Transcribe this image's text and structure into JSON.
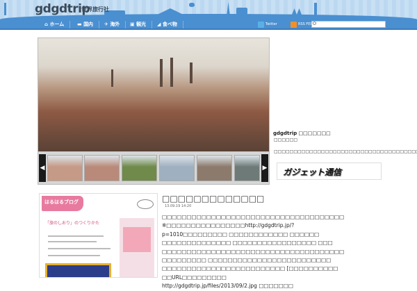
{
  "header": {
    "logo": "gdgdtrip",
    "logo_sub": "世界旅行社",
    "nav": [
      {
        "label": "ホーム",
        "icon": "home-icon"
      },
      {
        "label": "国内",
        "icon": "car-icon"
      },
      {
        "label": "海外",
        "icon": "plane-icon"
      },
      {
        "label": "観光",
        "icon": "camera-icon"
      },
      {
        "label": "食べ物",
        "icon": "food-icon"
      }
    ],
    "twitter_label": "Twitter",
    "rss_label": "RSS FEED",
    "search_placeholder": ""
  },
  "slider": {
    "prev_label": "◀",
    "next_label": "▶",
    "thumbs": [
      "#c59a86",
      "#b98a7a",
      "#6f8a4a",
      "#9fb0c0",
      "#8c7a6c",
      "#6d7a78"
    ]
  },
  "sidebar": {
    "title": "gdgdtrip",
    "title_suffix": "□□□□□□□",
    "subtitle": "□□□□□□",
    "description": "□□□□□□□□□□□□□□□□□□□□□□□□□□□□□□□□□□□□□□□",
    "banner_label": "ガジェット通信"
  },
  "post": {
    "thumb_blog": "はるはるブログ",
    "thumb_title": "「旅のしおり」のつくりかた",
    "title": "□□□□□□□□□□□□□",
    "date": "13.09.19 14:20",
    "body": [
      "□□□□□□□□□□□□□□□□□□□□□□□□□□□□□□□□□□□□□",
      "※□□□□□□□□□□□□□□□□http://gdgdtrip.jp/?",
      "p=1010□□□□□□□□□ □□□□□□□□□□□□ □□□□□□",
      "□□□□□□□□□□□□□□ □□□□□□□□□□□□□□□□□ □□□",
      "□□□□□□□□□□□□□□□□□□□□□□□□□□□□□□□□□□□□□",
      "□□□□□□□□□ □□□□□□□□□□□□□□□□□□□□□□□□□",
      "□□□□□□□□□□□□□□□□□□□□□□□□□ [□□□□□□□□□□",
      "□□URL□□□□□□□□□",
      "http://gdgdtrip.jp/files/2013/09/2.jpg □□□□□□□"
    ]
  },
  "colors": {
    "nav": "#4a8fd0",
    "sky": "#c8e0f4",
    "accent_pink": "#e87aa0"
  }
}
